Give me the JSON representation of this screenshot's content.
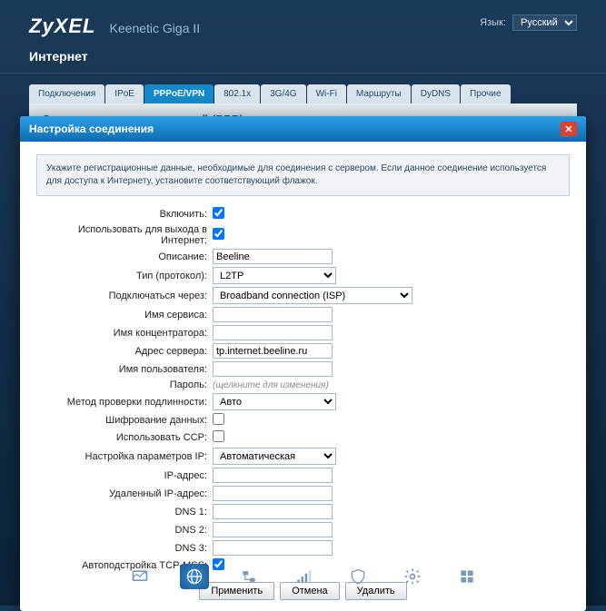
{
  "header": {
    "brand": "ZyXEL",
    "model": "Keenetic Giga II",
    "lang_label": "Язык:",
    "lang_value": "Русский"
  },
  "section": "Интернет",
  "tabs": [
    "Подключения",
    "IPoE",
    "PPPoE/VPN",
    "802.1x",
    "3G/4G",
    "Wi-Fi",
    "Маршруты",
    "DyDNS",
    "Прочие"
  ],
  "content_title": "Соединения с авторизацией (PPP)",
  "modal": {
    "title": "Настройка соединения",
    "info": "Укажите регистрационные данные, необходимые для соединения с сервером. Если данное соединение используется для доступа к Интернету, установите соответствующий флажок.",
    "fields": {
      "enable": "Включить:",
      "use_internet": "Использовать для выхода в Интернет:",
      "description": "Описание:",
      "description_val": "Beeline",
      "type": "Тип (протокол):",
      "type_val": "L2TP",
      "connect_via": "Подключаться через:",
      "connect_via_val": "Broadband connection (ISP)",
      "service_name": "Имя сервиса:",
      "concentrator": "Имя концентратора:",
      "server_addr": "Адрес сервера:",
      "server_addr_val": "tp.internet.beeline.ru",
      "username": "Имя пользователя:",
      "password": "Пароль:",
      "password_hint": "(щелкните для изменения)",
      "auth_method": "Метод проверки подлинности:",
      "auth_method_val": "Авто",
      "encrypt": "Шифрование данных:",
      "use_ccp": "Использовать CCP:",
      "ip_config": "Настройка параметров IP:",
      "ip_config_val": "Автоматическая",
      "ip_addr": "IP-адрес:",
      "remote_ip": "Удаленный IP-адрес:",
      "dns1": "DNS 1:",
      "dns2": "DNS 2:",
      "dns3": "DNS 3:",
      "tcp_mss": "Автоподстройка TCP-MSS:"
    },
    "buttons": {
      "apply": "Применить",
      "cancel": "Отмена",
      "delete": "Удалить"
    }
  }
}
